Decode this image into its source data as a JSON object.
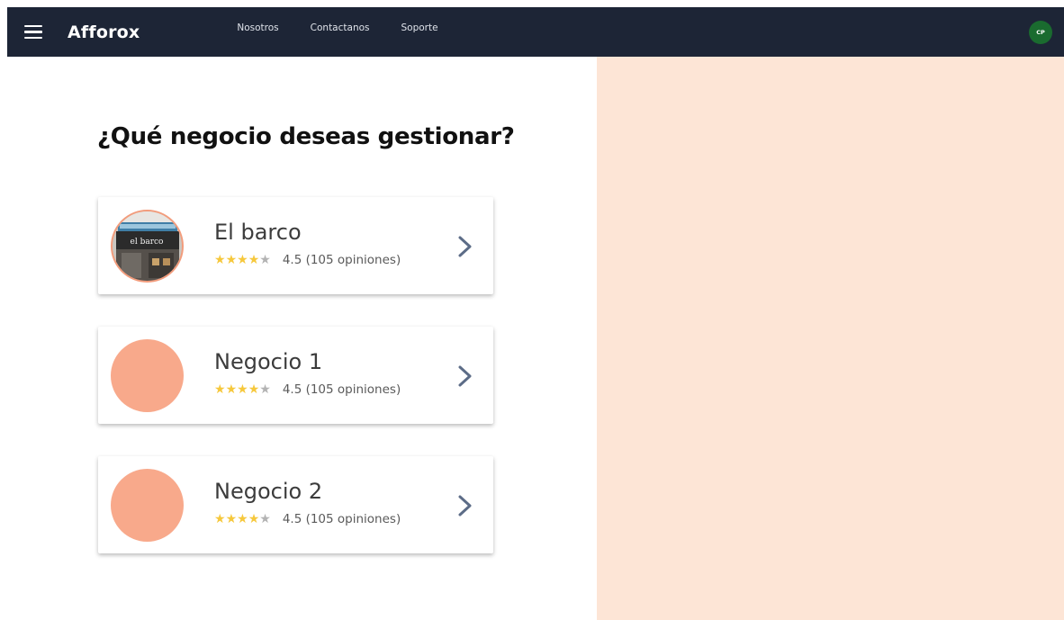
{
  "header": {
    "brand": "Afforox",
    "nav": [
      "Nosotros",
      "Contactanos",
      "Soporte"
    ],
    "avatar_initials": "CP"
  },
  "main": {
    "title": "¿Qué negocio deseas gestionar?",
    "businesses": [
      {
        "name": "El barco",
        "rating_text": "4.5 (105 opiniones)",
        "stars": 4,
        "photo_sign": "el barco"
      },
      {
        "name": "Negocio 1",
        "rating_text": "4.5 (105 opiniones)",
        "stars": 4
      },
      {
        "name": "Negocio 2",
        "rating_text": "4.5 (105 opiniones)",
        "stars": 4
      }
    ]
  },
  "colors": {
    "topbar": "#1d2536",
    "accent": "#f8a98b",
    "side_panel": "#fde5d6",
    "star": "#f6c83c",
    "avatar": "#1a6b2f",
    "chevron": "#5c6c87"
  }
}
